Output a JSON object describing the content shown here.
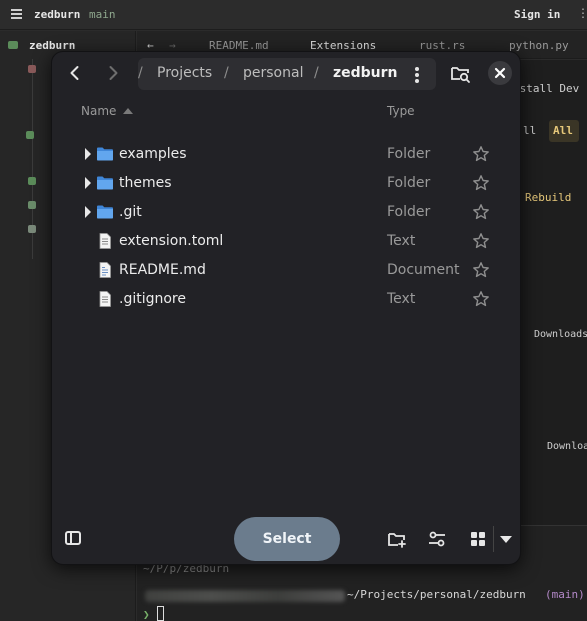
{
  "titlebar": {
    "project": "zedburn",
    "branch": "main",
    "sign_in": "Sign in",
    "overflow": "⋮"
  },
  "project_panel": {
    "root": "zedburn"
  },
  "tabs": [
    {
      "label": "←"
    },
    {
      "label": "→"
    },
    {
      "label": "README.md"
    },
    {
      "label": "Extensions"
    },
    {
      "label": "rust.rs"
    },
    {
      "label": "python.py"
    }
  ],
  "editor": {
    "install_dev": "nstall Dev",
    "all_prefix": "ll",
    "all_btn": "All",
    "rebuild": "Rebuild",
    "downloads_1": "Downloads",
    "downloads_2": "Downloa"
  },
  "terminal": {
    "line1": "~/P/p/zedburn",
    "path": "~/Projects/personal/zedburn",
    "branch": "(main)",
    "prompt": "❯"
  },
  "dialog": {
    "path": [
      "/",
      "Projects",
      "/",
      "personal",
      "/",
      "zedburn"
    ],
    "col_name": "Name",
    "col_type": "Type",
    "files": [
      {
        "name": "examples",
        "type": "Folder",
        "kind": "folder"
      },
      {
        "name": "themes",
        "type": "Folder",
        "kind": "folder"
      },
      {
        "name": ".git",
        "type": "Folder",
        "kind": "folder"
      },
      {
        "name": "extension.toml",
        "type": "Text",
        "kind": "text"
      },
      {
        "name": "README.md",
        "type": "Document",
        "kind": "document"
      },
      {
        "name": ".gitignore",
        "type": "Text",
        "kind": "text"
      }
    ],
    "select_label": "Select"
  },
  "colors": {
    "folder": "#5ea3ea",
    "select_bg": "#6b7c8d",
    "dialog_bg": "#222226",
    "terminal_branch": "#b489c9"
  }
}
